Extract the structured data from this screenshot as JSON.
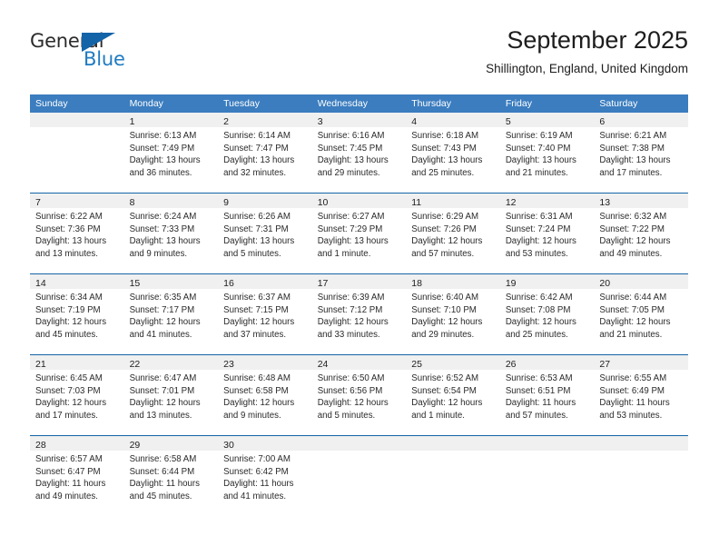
{
  "brand": {
    "name_top": "General",
    "name_bottom": "Blue"
  },
  "header": {
    "title": "September 2025",
    "location": "Shillington, England, United Kingdom"
  },
  "calendar": {
    "day_headers": [
      "Sunday",
      "Monday",
      "Tuesday",
      "Wednesday",
      "Thursday",
      "Friday",
      "Saturday"
    ],
    "labels": {
      "sunrise": "Sunrise:",
      "sunset": "Sunset:",
      "daylight": "Daylight:"
    },
    "colors": {
      "header_blue": "#3b7dbf",
      "separator_blue": "#1565a8",
      "daynum_band": "#f0f0f0",
      "brand_blue": "#1f7bc1"
    },
    "weeks": [
      [
        {
          "day": "",
          "sunrise": "",
          "sunset": "",
          "daylight_line1": "",
          "daylight_line2": ""
        },
        {
          "day": "1",
          "sunrise": "Sunrise: 6:13 AM",
          "sunset": "Sunset: 7:49 PM",
          "daylight_line1": "Daylight: 13 hours",
          "daylight_line2": "and 36 minutes."
        },
        {
          "day": "2",
          "sunrise": "Sunrise: 6:14 AM",
          "sunset": "Sunset: 7:47 PM",
          "daylight_line1": "Daylight: 13 hours",
          "daylight_line2": "and 32 minutes."
        },
        {
          "day": "3",
          "sunrise": "Sunrise: 6:16 AM",
          "sunset": "Sunset: 7:45 PM",
          "daylight_line1": "Daylight: 13 hours",
          "daylight_line2": "and 29 minutes."
        },
        {
          "day": "4",
          "sunrise": "Sunrise: 6:18 AM",
          "sunset": "Sunset: 7:43 PM",
          "daylight_line1": "Daylight: 13 hours",
          "daylight_line2": "and 25 minutes."
        },
        {
          "day": "5",
          "sunrise": "Sunrise: 6:19 AM",
          "sunset": "Sunset: 7:40 PM",
          "daylight_line1": "Daylight: 13 hours",
          "daylight_line2": "and 21 minutes."
        },
        {
          "day": "6",
          "sunrise": "Sunrise: 6:21 AM",
          "sunset": "Sunset: 7:38 PM",
          "daylight_line1": "Daylight: 13 hours",
          "daylight_line2": "and 17 minutes."
        }
      ],
      [
        {
          "day": "7",
          "sunrise": "Sunrise: 6:22 AM",
          "sunset": "Sunset: 7:36 PM",
          "daylight_line1": "Daylight: 13 hours",
          "daylight_line2": "and 13 minutes."
        },
        {
          "day": "8",
          "sunrise": "Sunrise: 6:24 AM",
          "sunset": "Sunset: 7:33 PM",
          "daylight_line1": "Daylight: 13 hours",
          "daylight_line2": "and 9 minutes."
        },
        {
          "day": "9",
          "sunrise": "Sunrise: 6:26 AM",
          "sunset": "Sunset: 7:31 PM",
          "daylight_line1": "Daylight: 13 hours",
          "daylight_line2": "and 5 minutes."
        },
        {
          "day": "10",
          "sunrise": "Sunrise: 6:27 AM",
          "sunset": "Sunset: 7:29 PM",
          "daylight_line1": "Daylight: 13 hours",
          "daylight_line2": "and 1 minute."
        },
        {
          "day": "11",
          "sunrise": "Sunrise: 6:29 AM",
          "sunset": "Sunset: 7:26 PM",
          "daylight_line1": "Daylight: 12 hours",
          "daylight_line2": "and 57 minutes."
        },
        {
          "day": "12",
          "sunrise": "Sunrise: 6:31 AM",
          "sunset": "Sunset: 7:24 PM",
          "daylight_line1": "Daylight: 12 hours",
          "daylight_line2": "and 53 minutes."
        },
        {
          "day": "13",
          "sunrise": "Sunrise: 6:32 AM",
          "sunset": "Sunset: 7:22 PM",
          "daylight_line1": "Daylight: 12 hours",
          "daylight_line2": "and 49 minutes."
        }
      ],
      [
        {
          "day": "14",
          "sunrise": "Sunrise: 6:34 AM",
          "sunset": "Sunset: 7:19 PM",
          "daylight_line1": "Daylight: 12 hours",
          "daylight_line2": "and 45 minutes."
        },
        {
          "day": "15",
          "sunrise": "Sunrise: 6:35 AM",
          "sunset": "Sunset: 7:17 PM",
          "daylight_line1": "Daylight: 12 hours",
          "daylight_line2": "and 41 minutes."
        },
        {
          "day": "16",
          "sunrise": "Sunrise: 6:37 AM",
          "sunset": "Sunset: 7:15 PM",
          "daylight_line1": "Daylight: 12 hours",
          "daylight_line2": "and 37 minutes."
        },
        {
          "day": "17",
          "sunrise": "Sunrise: 6:39 AM",
          "sunset": "Sunset: 7:12 PM",
          "daylight_line1": "Daylight: 12 hours",
          "daylight_line2": "and 33 minutes."
        },
        {
          "day": "18",
          "sunrise": "Sunrise: 6:40 AM",
          "sunset": "Sunset: 7:10 PM",
          "daylight_line1": "Daylight: 12 hours",
          "daylight_line2": "and 29 minutes."
        },
        {
          "day": "19",
          "sunrise": "Sunrise: 6:42 AM",
          "sunset": "Sunset: 7:08 PM",
          "daylight_line1": "Daylight: 12 hours",
          "daylight_line2": "and 25 minutes."
        },
        {
          "day": "20",
          "sunrise": "Sunrise: 6:44 AM",
          "sunset": "Sunset: 7:05 PM",
          "daylight_line1": "Daylight: 12 hours",
          "daylight_line2": "and 21 minutes."
        }
      ],
      [
        {
          "day": "21",
          "sunrise": "Sunrise: 6:45 AM",
          "sunset": "Sunset: 7:03 PM",
          "daylight_line1": "Daylight: 12 hours",
          "daylight_line2": "and 17 minutes."
        },
        {
          "day": "22",
          "sunrise": "Sunrise: 6:47 AM",
          "sunset": "Sunset: 7:01 PM",
          "daylight_line1": "Daylight: 12 hours",
          "daylight_line2": "and 13 minutes."
        },
        {
          "day": "23",
          "sunrise": "Sunrise: 6:48 AM",
          "sunset": "Sunset: 6:58 PM",
          "daylight_line1": "Daylight: 12 hours",
          "daylight_line2": "and 9 minutes."
        },
        {
          "day": "24",
          "sunrise": "Sunrise: 6:50 AM",
          "sunset": "Sunset: 6:56 PM",
          "daylight_line1": "Daylight: 12 hours",
          "daylight_line2": "and 5 minutes."
        },
        {
          "day": "25",
          "sunrise": "Sunrise: 6:52 AM",
          "sunset": "Sunset: 6:54 PM",
          "daylight_line1": "Daylight: 12 hours",
          "daylight_line2": "and 1 minute."
        },
        {
          "day": "26",
          "sunrise": "Sunrise: 6:53 AM",
          "sunset": "Sunset: 6:51 PM",
          "daylight_line1": "Daylight: 11 hours",
          "daylight_line2": "and 57 minutes."
        },
        {
          "day": "27",
          "sunrise": "Sunrise: 6:55 AM",
          "sunset": "Sunset: 6:49 PM",
          "daylight_line1": "Daylight: 11 hours",
          "daylight_line2": "and 53 minutes."
        }
      ],
      [
        {
          "day": "28",
          "sunrise": "Sunrise: 6:57 AM",
          "sunset": "Sunset: 6:47 PM",
          "daylight_line1": "Daylight: 11 hours",
          "daylight_line2": "and 49 minutes."
        },
        {
          "day": "29",
          "sunrise": "Sunrise: 6:58 AM",
          "sunset": "Sunset: 6:44 PM",
          "daylight_line1": "Daylight: 11 hours",
          "daylight_line2": "and 45 minutes."
        },
        {
          "day": "30",
          "sunrise": "Sunrise: 7:00 AM",
          "sunset": "Sunset: 6:42 PM",
          "daylight_line1": "Daylight: 11 hours",
          "daylight_line2": "and 41 minutes."
        },
        {
          "day": "",
          "sunrise": "",
          "sunset": "",
          "daylight_line1": "",
          "daylight_line2": ""
        },
        {
          "day": "",
          "sunrise": "",
          "sunset": "",
          "daylight_line1": "",
          "daylight_line2": ""
        },
        {
          "day": "",
          "sunrise": "",
          "sunset": "",
          "daylight_line1": "",
          "daylight_line2": ""
        },
        {
          "day": "",
          "sunrise": "",
          "sunset": "",
          "daylight_line1": "",
          "daylight_line2": ""
        }
      ]
    ]
  }
}
